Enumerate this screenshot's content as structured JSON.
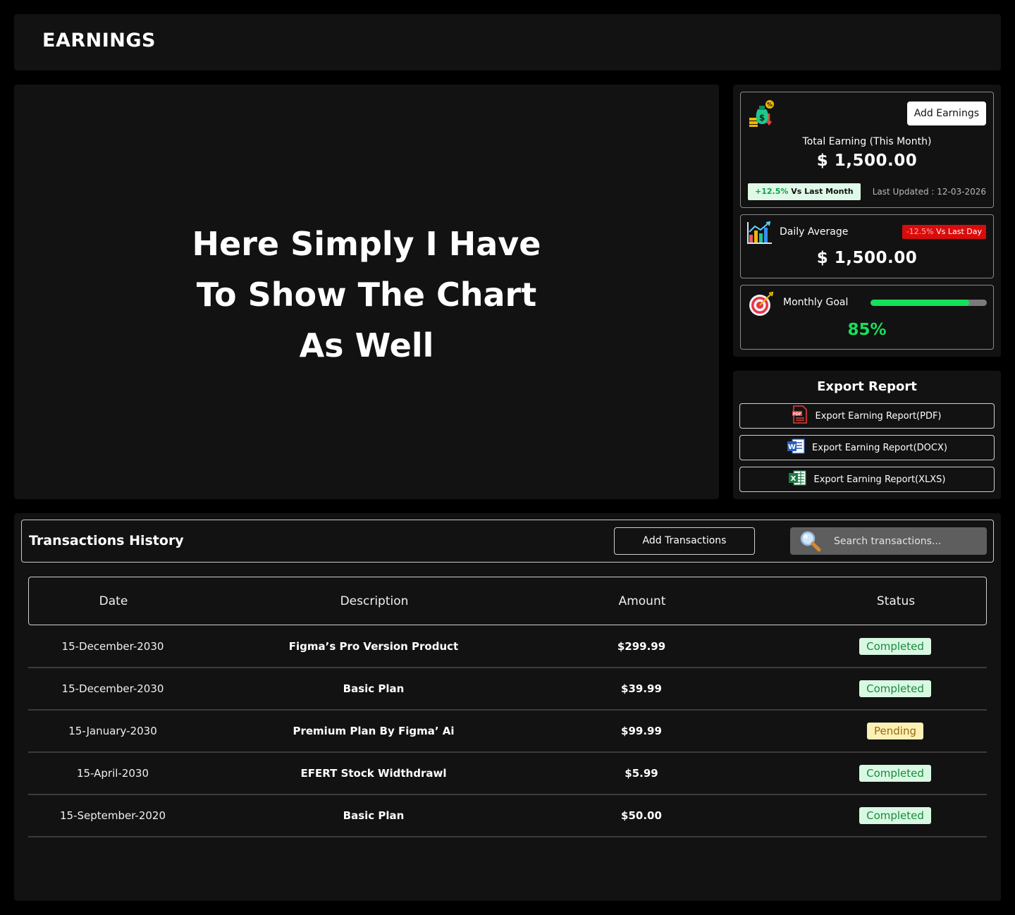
{
  "header": {
    "title": "EARNINGS"
  },
  "chart_area": {
    "placeholder_text": "Here Simply I Have\nTo Show The Chart\nAs Well"
  },
  "total_earning": {
    "button_label": "Add Earnings",
    "label": "Total Earning (This Month)",
    "amount": "$  1,500.00",
    "badge_change": "+12.5%",
    "badge_text": " Vs Last Month",
    "last_updated": "Last Updated : 12-03-2026",
    "icon": "money-bag-icon"
  },
  "daily_average": {
    "label": "Daily Average",
    "badge_change": "-12.5%",
    "badge_text": " Vs Last Day",
    "amount": "$  1,500.00",
    "icon": "bar-chart-icon"
  },
  "monthly_goal": {
    "label": "Monthly Goal",
    "progress": 0.85,
    "percent_text": "85%",
    "icon": "target-icon"
  },
  "export": {
    "title": "Export Report",
    "buttons": [
      {
        "label": "Export Earning Report(PDF)",
        "icon": "pdf-icon"
      },
      {
        "label": "Export Earning Report(DOCX)",
        "icon": "word-icon"
      },
      {
        "label": "Export Earning Report(XLXS)",
        "icon": "excel-icon"
      }
    ]
  },
  "transactions": {
    "title": "Transactions History",
    "add_button": "Add Transactions",
    "search_placeholder": "Search transactions...",
    "columns": [
      "Date",
      "Description",
      "Amount",
      "Status"
    ],
    "rows": [
      {
        "date": "15-December-2030",
        "description": "Figma’s Pro Version Product",
        "amount": "$299.99",
        "status": "Completed"
      },
      {
        "date": "15-December-2030",
        "description": "Basic Plan",
        "amount": "$39.99",
        "status": "Completed"
      },
      {
        "date": "15-January-2030",
        "description": "Premium Plan By Figma’ Ai",
        "amount": "$99.99",
        "status": "Pending"
      },
      {
        "date": "15-April-2030",
        "description": "EFERT Stock Widthdrawl",
        "amount": "$5.99",
        "status": "Completed"
      },
      {
        "date": "15-September-2020",
        "description": "Basic Plan",
        "amount": "$50.00",
        "status": "Completed"
      }
    ]
  },
  "colors": {
    "background": "#000000",
    "panel": "#121212",
    "positive": "#16e05a",
    "negative": "#d80c0c",
    "completed_bg": "#d9f8e3",
    "pending_bg": "#fbf0b5"
  }
}
